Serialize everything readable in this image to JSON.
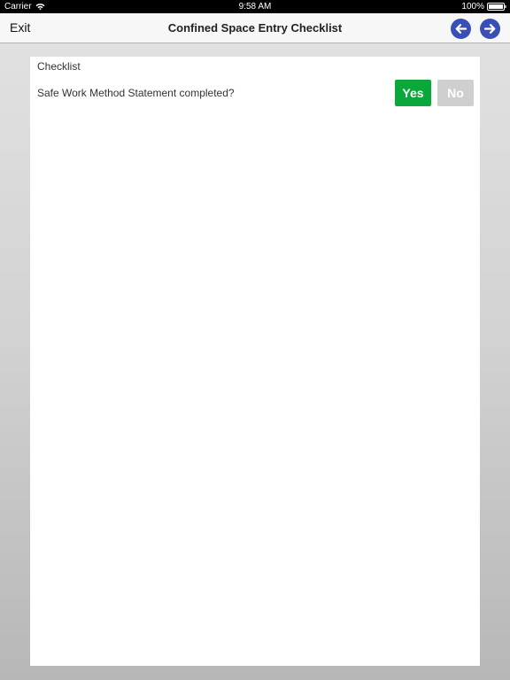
{
  "status_bar": {
    "carrier": "Carrier",
    "time": "9:58 AM",
    "battery": "100%"
  },
  "nav": {
    "exit_label": "Exit",
    "title": "Confined Space Entry Checklist",
    "back_icon": "arrow-left-icon",
    "forward_icon": "arrow-right-icon",
    "arrow_color": "#3a4fb6"
  },
  "checklist": {
    "section_label": "Checklist",
    "items": [
      {
        "question": "Safe Work Method Statement completed?",
        "yes_label": "Yes",
        "no_label": "No",
        "selected": "Yes"
      }
    ]
  },
  "colors": {
    "yes_selected": "#0aa83a",
    "no_unselected": "#cfcfcf"
  }
}
